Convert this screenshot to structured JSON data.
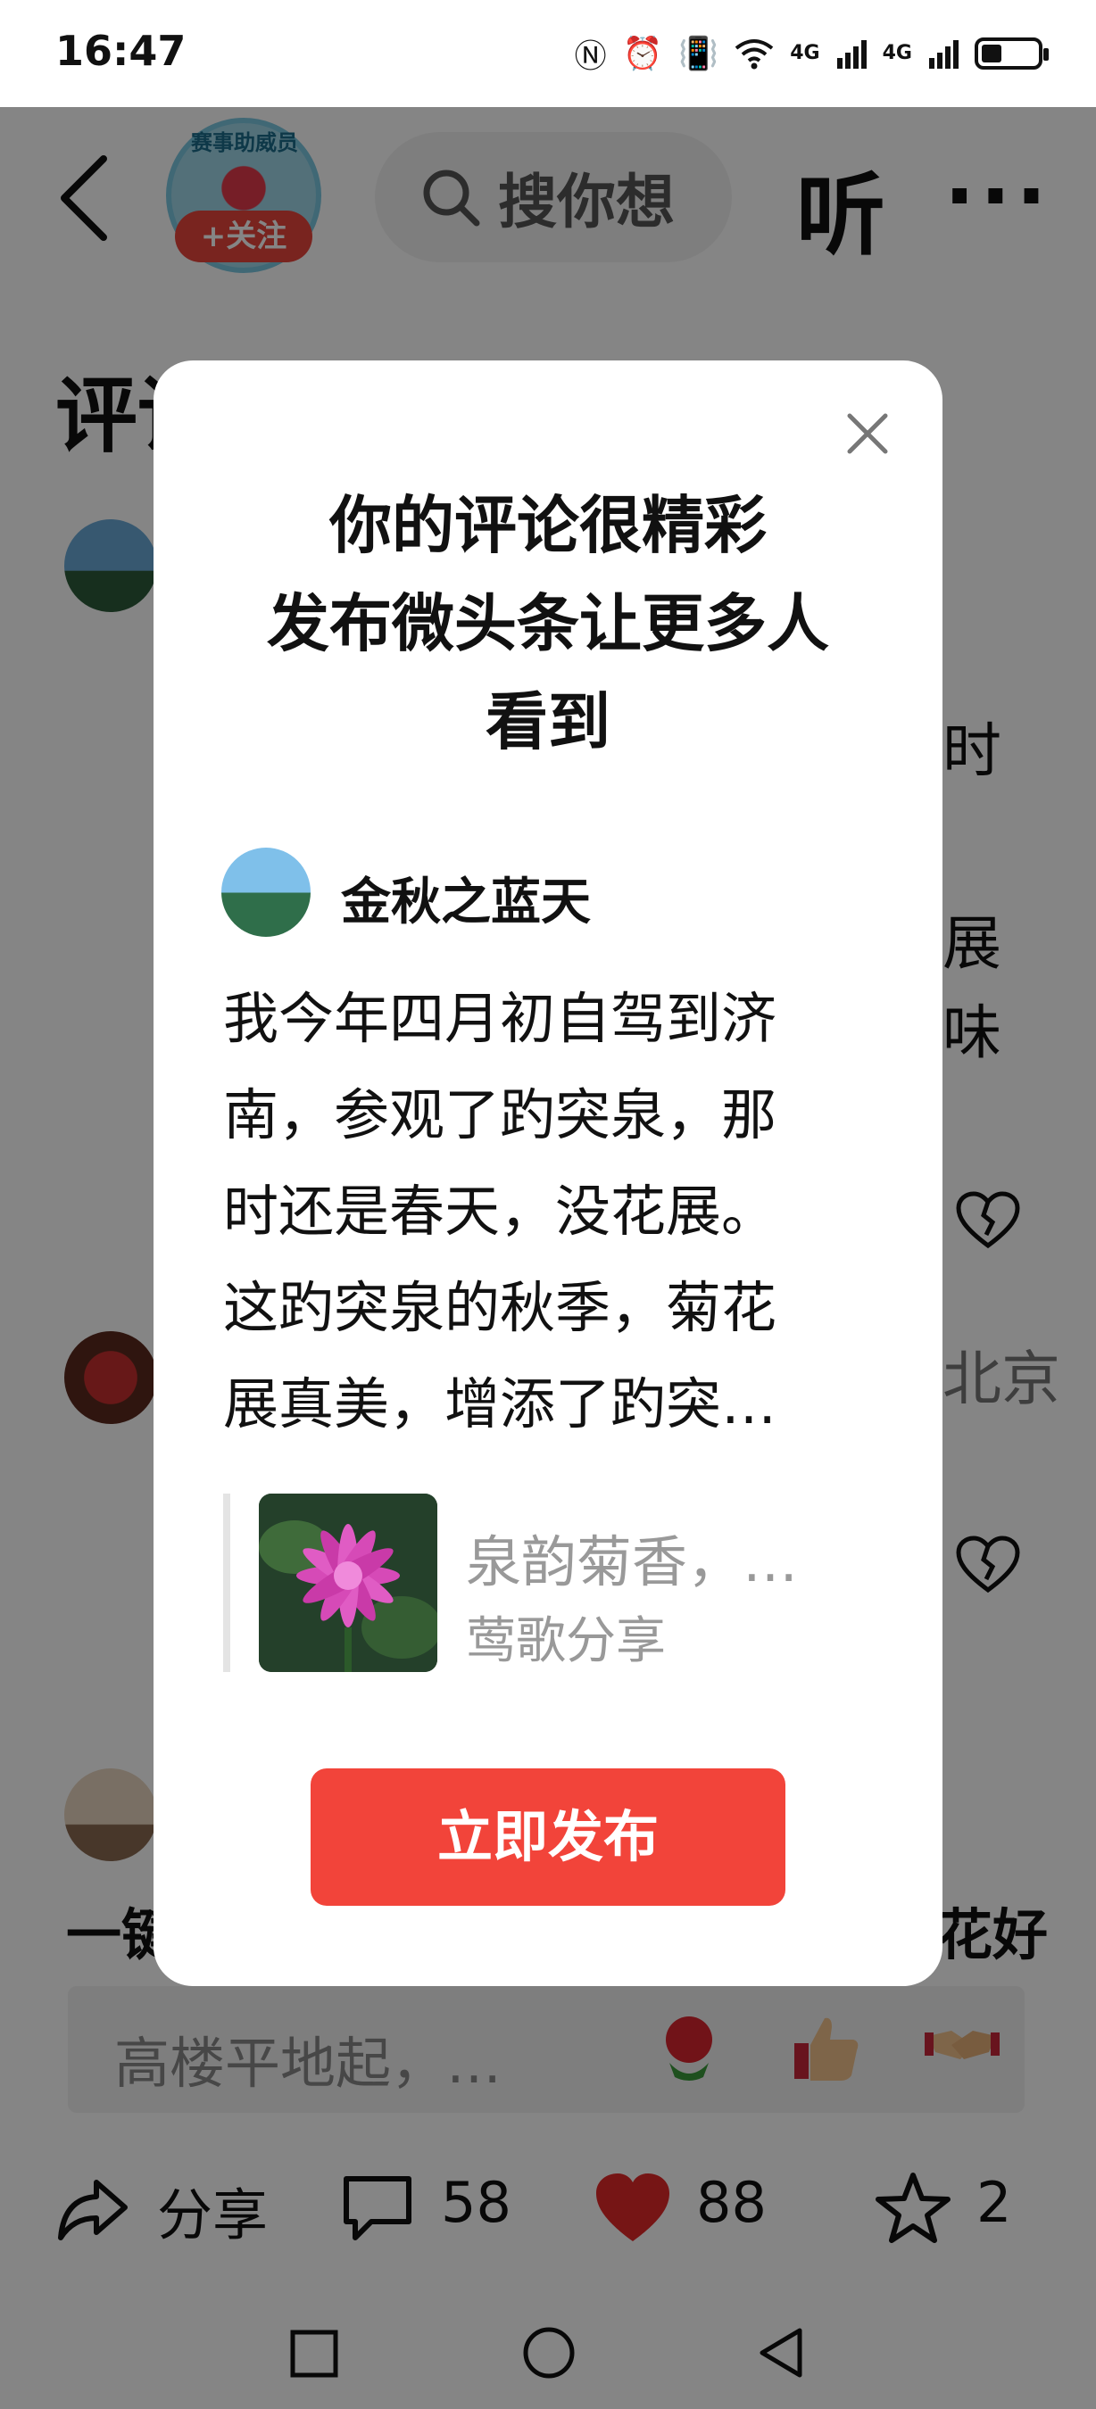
{
  "status_bar": {
    "time": "16:47",
    "signal_1": "4G",
    "signal_2": "4G"
  },
  "header": {
    "avatar_badge": "赛事助威员",
    "follow_label": "+关注",
    "search_placeholder": "搜你想",
    "listen_label": "听",
    "more_label": "···"
  },
  "background": {
    "section_title": "评论",
    "right_chars": [
      "时",
      "展",
      "味",
      "北京"
    ],
    "bottom_line_left": "一键",
    "bottom_line_right": "花好漂"
  },
  "comment_bar": {
    "placeholder": "高楼平地起，…"
  },
  "actions": {
    "share_label": "分享",
    "comment_count": "58",
    "like_count": "88",
    "favorite_count": "2"
  },
  "modal": {
    "title_lines": [
      "你的评论很精彩",
      "发布微头条让更多人",
      "看到"
    ],
    "username": "金秋之蓝天",
    "body_lines": [
      "我今年四月初自驾到济",
      "南，参观了趵突泉，那",
      "时还是春天，没花展。",
      "这趵突泉的秋季，菊花",
      "展真美，增添了趵突…"
    ],
    "quote_title": "泉韵菊香，…",
    "quote_author": "莺歌分享",
    "publish_button": "立即发布",
    "accent_color": "#f2443a"
  }
}
